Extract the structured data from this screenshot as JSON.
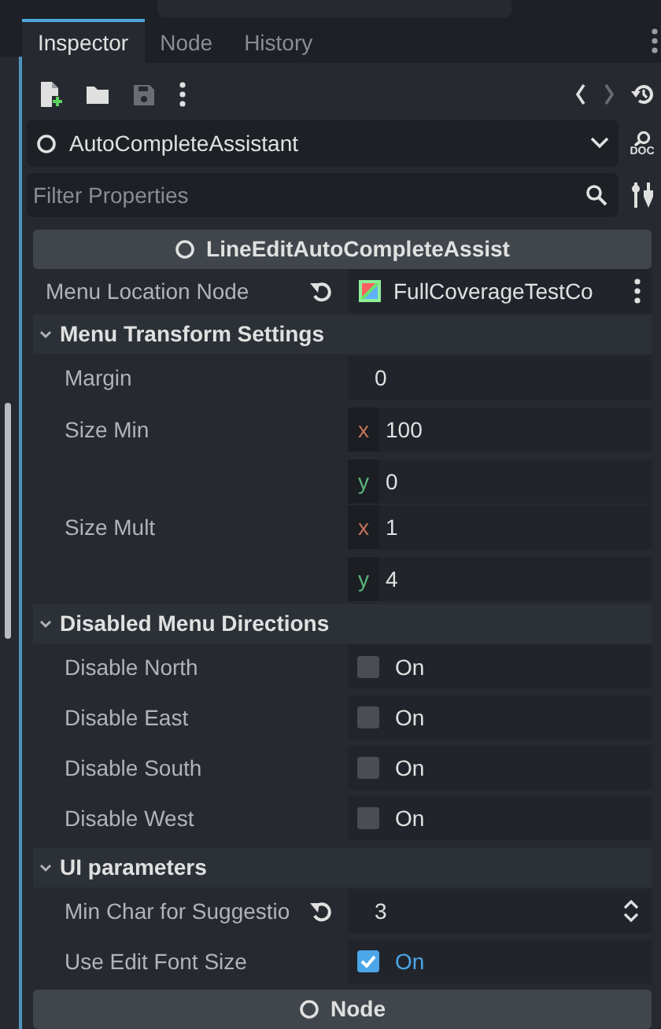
{
  "tabs": [
    {
      "label": "Inspector",
      "selected": true
    },
    {
      "label": "Node",
      "selected": false
    },
    {
      "label": "History",
      "selected": false
    }
  ],
  "toolbar": {
    "save_disabled": true
  },
  "object_selector": {
    "name": "AutoCompleteAssistant",
    "doc_label": "DOC"
  },
  "filter": {
    "placeholder": "Filter Properties"
  },
  "items": [
    {
      "kind": "class",
      "label": "LineEditAutoCompleteAssist"
    },
    {
      "kind": "node",
      "label": "Menu Location Node",
      "revertable": true,
      "value": "FullCoverageTestCo"
    },
    {
      "kind": "group",
      "label": "Menu Transform Settings",
      "expanded": true,
      "properties": [
        {
          "kind": "number",
          "label": "Margin",
          "value": "0"
        },
        {
          "kind": "vector",
          "label": "Size Min",
          "components": [
            {
              "axis": "x",
              "value": "100"
            },
            {
              "axis": "y",
              "value": "0"
            }
          ]
        },
        {
          "kind": "vector",
          "label": "Size Mult",
          "components": [
            {
              "axis": "x",
              "value": "1"
            },
            {
              "axis": "y",
              "value": "4"
            }
          ]
        }
      ]
    },
    {
      "kind": "group",
      "label": "Disabled Menu Directions",
      "expanded": true,
      "properties": [
        {
          "kind": "checkbox",
          "label": "Disable North",
          "checked": false,
          "text": "On"
        },
        {
          "kind": "checkbox",
          "label": "Disable East",
          "checked": false,
          "text": "On"
        },
        {
          "kind": "checkbox",
          "label": "Disable South",
          "checked": false,
          "text": "On"
        },
        {
          "kind": "checkbox",
          "label": "Disable West",
          "checked": false,
          "text": "On"
        }
      ]
    },
    {
      "kind": "group",
      "label": "UI parameters",
      "expanded": true,
      "properties": [
        {
          "kind": "spin",
          "label": "Min Char for Suggestio",
          "revertable": true,
          "value": "3"
        },
        {
          "kind": "checkbox",
          "label": "Use Edit Font Size",
          "checked": true,
          "text": "On"
        }
      ]
    },
    {
      "kind": "class",
      "label": "Node"
    }
  ]
}
